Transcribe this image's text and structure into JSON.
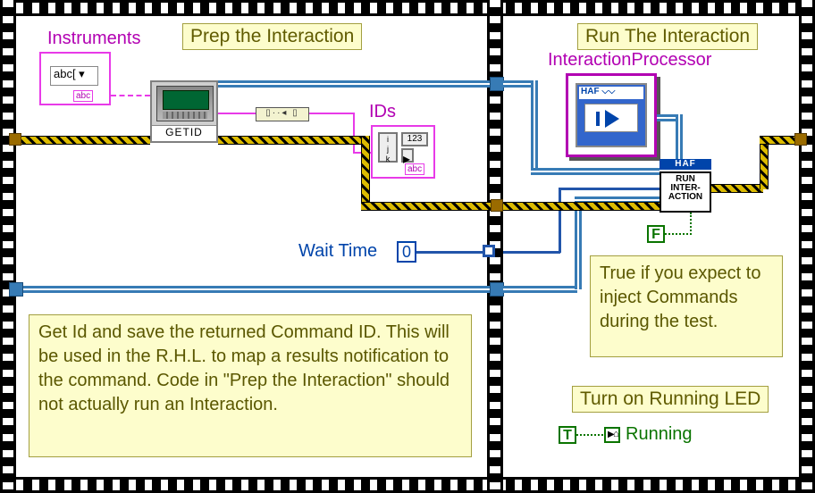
{
  "frame_left": {
    "title": "Prep the Interaction",
    "instruments_label": "Instruments",
    "getid_label": "GETID",
    "ids_label": "IDs",
    "wait_label": "Wait Time",
    "wait_value": "0",
    "comment": "Get Id and save the returned Command ID.  This will be used in the R.H.L. to map a results notification to the command.  Code in \"Prep the Interaction\" should not actually run an Interaction.",
    "build_array_glyph": "▯··◂ ▯"
  },
  "frame_right": {
    "title": "Run The Interaction",
    "processor_label": "InteractionProcessor",
    "haf_label": "HAF",
    "run_inter_text": "RUN INTER-ACTION",
    "expect_inject_comment": "True if you expect to inject Commands during the test.",
    "expect_inject_value": "F",
    "led_label": "Turn on Running LED",
    "running_bool": "T",
    "running_label": "Running"
  }
}
